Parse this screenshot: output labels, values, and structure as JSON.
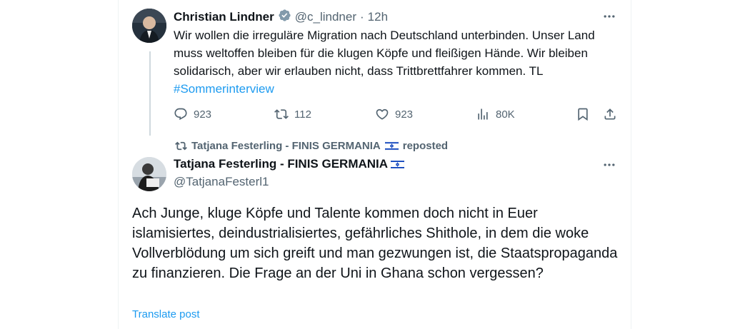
{
  "tweet1": {
    "name": "Christian Lindner",
    "handle": "@c_lindner",
    "separator": "·",
    "time": "12h",
    "text_before": "Wir wollen die irreguläre Migration nach Deutschland unterbinden. Unser Land muss weltoffen bleiben für die klugen Köpfe und fleißigen Hände. Wir bleiben solidarisch, aber wir erlauben nicht, dass Trittbrettfahrer kommen. TL ",
    "hashtag": "#Sommerinterview",
    "replies": "923",
    "reposts": "112",
    "likes": "923",
    "views": "80K",
    "verified_color": "#829aab"
  },
  "repost_notice": {
    "text": "Tatjana Festerling - FINIS GERMANIA",
    "suffix": "reposted"
  },
  "tweet2": {
    "name": "Tatjana Festerling - FINIS GERMANIA",
    "handle": "@TatjanaFesterl1",
    "text": "Ach Junge, kluge Köpfe und Talente kommen doch nicht in Euer islamisiertes, deindustrialisiertes, gefährliches Shithole, in dem die woke Vollverblödung um sich greift und man gezwungen ist, die Staatspropaganda zu finanzieren. Die Frage an der Uni in Ghana schon vergessen?",
    "translate": "Translate post"
  },
  "colors": {
    "accent": "#1d9bf0",
    "muted": "#536471",
    "flag_blue": "#0038b8"
  }
}
